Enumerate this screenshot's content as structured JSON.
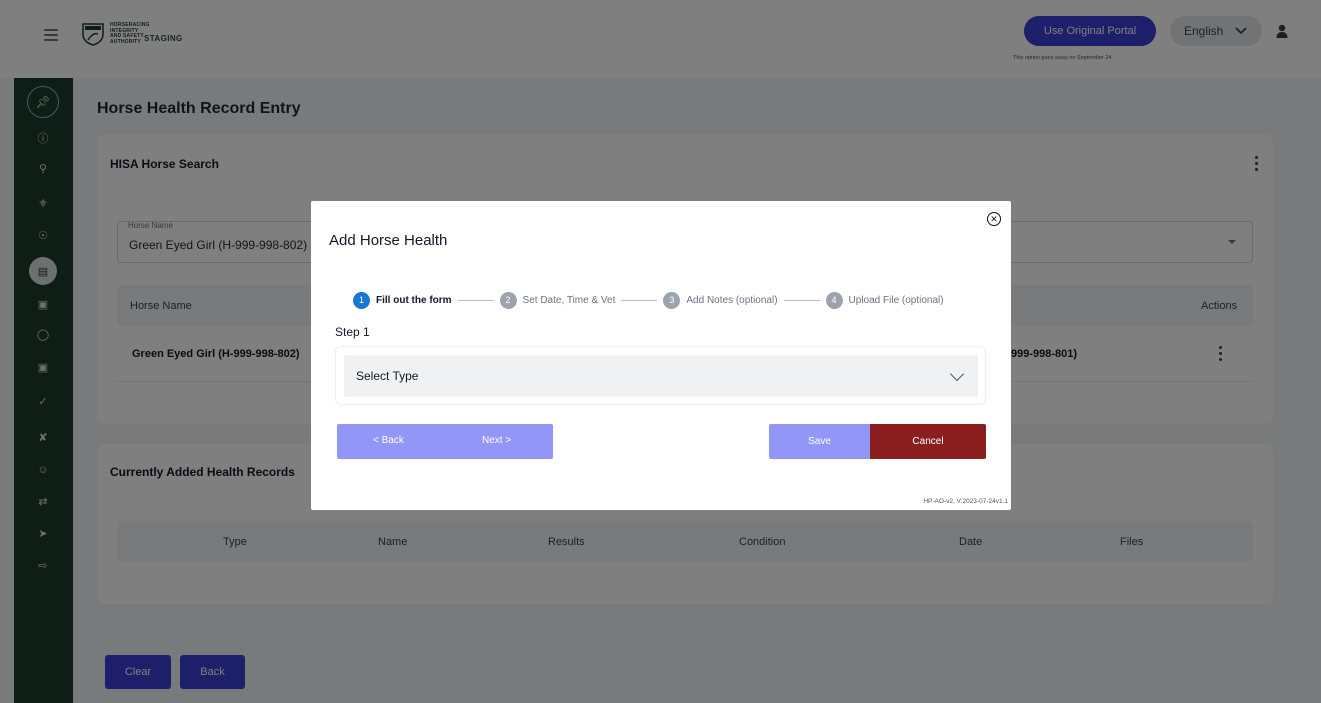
{
  "header": {
    "logo_lines": [
      "HORSERACING",
      "INTEGRITY",
      "AND SAFETY",
      "AUTHORITY"
    ],
    "environment": "STAGING",
    "original_portal_button": "Use Original Portal",
    "original_portal_note": "This option goes away on September 24",
    "language": "English"
  },
  "page": {
    "title": "Horse Health Record Entry"
  },
  "search_card": {
    "title": "HISA Horse Search",
    "horse_field_label": "Horse Name",
    "horse_field_value": "Green Eyed Girl (H-999-998-802)",
    "columns": [
      "Horse Name",
      "Actions"
    ],
    "row": {
      "horse_name": "Green Eyed Girl (H-999-998-802)",
      "partial_right": "999-998-801)"
    }
  },
  "records_card": {
    "title": "Currently Added Health Records",
    "columns": [
      "Type",
      "Name",
      "Results",
      "Condition",
      "Date",
      "Files"
    ]
  },
  "bottom_buttons": {
    "clear": "Clear",
    "back": "Back"
  },
  "modal": {
    "title": "Add Horse Health",
    "steps": [
      {
        "num": "1",
        "label": "Fill out the form"
      },
      {
        "num": "2",
        "label": "Set Date, Time & Vet"
      },
      {
        "num": "3",
        "label": "Add Notes (optional)"
      },
      {
        "num": "4",
        "label": "Upload File (optional)"
      }
    ],
    "active_step": 1,
    "step_caption": "Step 1",
    "select_type": "Select Type",
    "back_label": "< Back",
    "next_label": "Next >",
    "save_label": "Save",
    "cancel_label": "Cancel",
    "version": "HP-AO-v2, V:2023-07-24v1.1"
  },
  "colors": {
    "primary": "#3a3fd6",
    "disabled_primary": "#9297f7",
    "cancel": "#8b1e1e",
    "sidebar": "#1d3a2c",
    "step_active": "#1976d2"
  }
}
